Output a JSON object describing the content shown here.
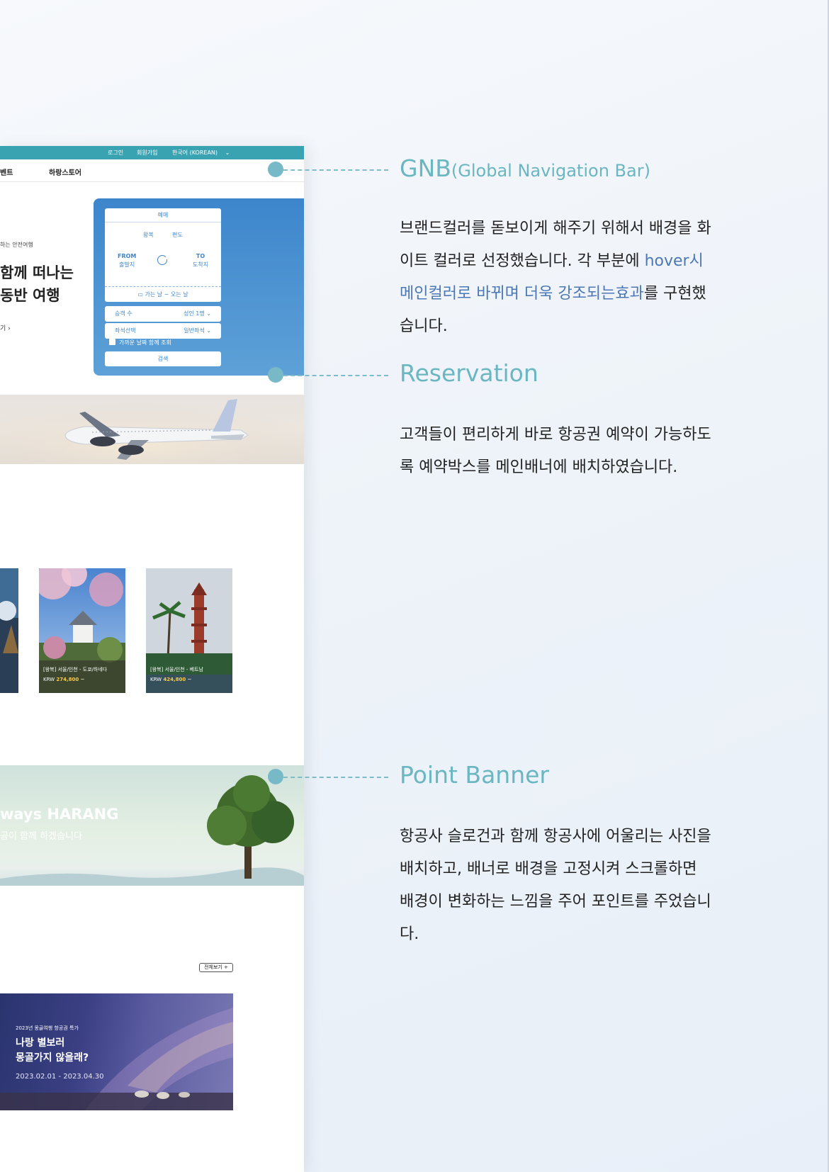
{
  "colors": {
    "brand_teal": "#3aa3b2",
    "reservation_blue": "#3d86cc",
    "annotation_teal": "#6ab6c1",
    "highlight_blue": "#4b78b5"
  },
  "mockup": {
    "topbar": {
      "login": "로그인",
      "signup": "회원가입",
      "language": "한국어 (KOREAN)"
    },
    "gnb": {
      "item_event": "벤트",
      "item_store": "하랑스토어"
    },
    "hero": {
      "subtitle": "하는 안전여행",
      "headline_1": "함께 떠나는",
      "headline_2": "동반 여행",
      "more_link": "기"
    },
    "reservation": {
      "tab": "예매",
      "round_trip": "왕복",
      "one_way": "편도",
      "from_label": "FROM",
      "from_value": "출발지",
      "to_label": "TO",
      "to_value": "도착지",
      "dates": "가는 날 ~ 오는 날",
      "passengers_label": "승객 수",
      "passengers_value": "성인 1명",
      "seat_label": "좌석선택",
      "seat_value": "일반좌석",
      "flexible_dates": "가까운 날짜 함께 조회",
      "search": "검색"
    },
    "cards": [
      {
        "title": "[왕복] 서울/인천 - 도쿄/하네다",
        "currency": "KRW",
        "price": "274,800",
        "suffix": "~"
      },
      {
        "title": "[왕복] 서울/인천 - 베트남",
        "currency": "KRW",
        "price": "424,800",
        "suffix": "~"
      }
    ],
    "point_banner": {
      "title": "ways HARANG",
      "subtitle": "공이 함께 하겠습니다"
    },
    "view_all": "전체보기 +",
    "promo": {
      "eyebrow": "2023년 몽골여행 항공권 특가",
      "title_1": "나랑 별보러",
      "title_2": "몽골가지 않을래?",
      "period": "2023.02.01 - 2023.04.30"
    }
  },
  "annotations": [
    {
      "title": "GNB",
      "title_small": "(Global Navigation Bar)",
      "desc_1": "브랜드컬러를 돋보이게 해주기 위해서 배경을 화이트 컬러로 선정했습니다. 각 부분에 ",
      "desc_highlight": "hover시 메인컬러로 바뀌며 더욱 강조되는효과",
      "desc_2": "를 구현했습니다."
    },
    {
      "title": "Reservation",
      "desc": "고객들이 편리하게 바로 항공권 예약이 가능하도록 예약박스를 메인배너에 배치하였습니다."
    },
    {
      "title": "Point Banner",
      "desc": "항공사 슬로건과 함께 항공사에 어울리는 사진을 배치하고, 배너로 배경을 고정시켜 스크롤하면 배경이 변화하는 느낌을 주어 포인트를 주었습니다."
    }
  ]
}
